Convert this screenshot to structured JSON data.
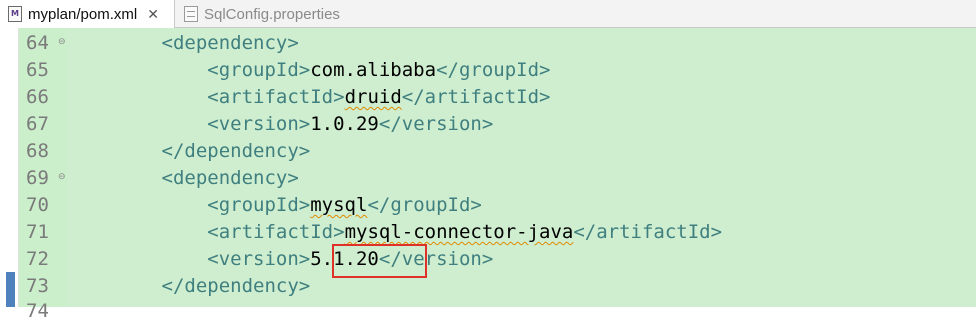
{
  "tabs": [
    {
      "label": "myplan/pom.xml",
      "icon": "maven-xml-file-icon",
      "active": true
    },
    {
      "label": "SqlConfig.properties",
      "icon": "properties-file-icon",
      "active": false
    }
  ],
  "editor": {
    "lines": [
      {
        "num": "64",
        "fold": true,
        "parts": [
          {
            "t": "<dependency>",
            "k": "tag"
          }
        ]
      },
      {
        "num": "65",
        "fold": false,
        "parts": [
          {
            "t": "<groupId>",
            "k": "tag"
          },
          {
            "t": "com.alibaba",
            "k": "txt"
          },
          {
            "t": "</groupId>",
            "k": "tag"
          }
        ]
      },
      {
        "num": "66",
        "fold": false,
        "parts": [
          {
            "t": "<artifactId>",
            "k": "tag"
          },
          {
            "t": "druid",
            "k": "spell"
          },
          {
            "t": "</artifactId>",
            "k": "tag"
          }
        ]
      },
      {
        "num": "67",
        "fold": false,
        "parts": [
          {
            "t": "<version>",
            "k": "tag"
          },
          {
            "t": "1.0.29",
            "k": "txt"
          },
          {
            "t": "</version>",
            "k": "tag"
          }
        ]
      },
      {
        "num": "68",
        "fold": false,
        "parts": [
          {
            "t": "</dependency>",
            "k": "tag"
          }
        ]
      },
      {
        "num": "69",
        "fold": true,
        "parts": [
          {
            "t": "<dependency>",
            "k": "tag"
          }
        ]
      },
      {
        "num": "70",
        "fold": false,
        "parts": [
          {
            "t": "<groupId>",
            "k": "tag"
          },
          {
            "t": "mysql",
            "k": "spell"
          },
          {
            "t": "</groupId>",
            "k": "tag"
          }
        ]
      },
      {
        "num": "71",
        "fold": false,
        "parts": [
          {
            "t": "<artifactId>",
            "k": "tag"
          },
          {
            "t": "mysql-connector-java",
            "k": "spell"
          },
          {
            "t": "</artifactId>",
            "k": "tag"
          }
        ]
      },
      {
        "num": "72",
        "fold": false,
        "parts": [
          {
            "t": "<version>",
            "k": "tag"
          },
          {
            "t": "5.1.20",
            "k": "txt"
          },
          {
            "t": "</version>",
            "k": "tag"
          }
        ]
      },
      {
        "num": "73",
        "fold": false,
        "parts": [
          {
            "t": "</dependency>",
            "k": "tag"
          }
        ]
      }
    ],
    "highlight_value": "5.1.20"
  },
  "colors": {
    "tag": "#3f7f7f",
    "text": "#000000",
    "line_number": "#7a7a7a",
    "highlight_background": "#cfeecf",
    "annotation_box": "#e0302a",
    "ruler_marker": "#4f81bd"
  }
}
